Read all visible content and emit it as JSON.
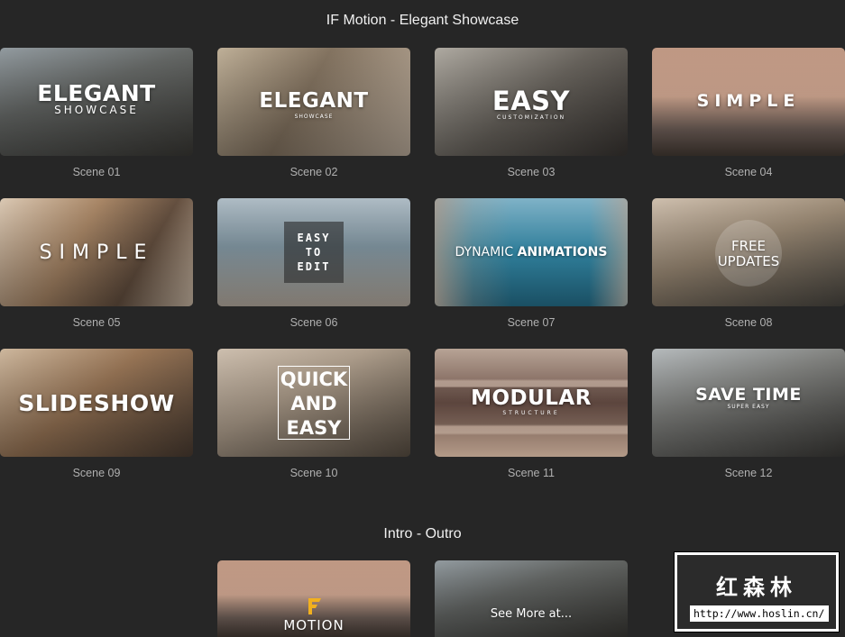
{
  "title": "IF Motion - Elegant Showcase",
  "scenes": [
    {
      "caption": "Scene 01",
      "overlay": [
        "ELEGANT",
        "SHOWCASE"
      ]
    },
    {
      "caption": "Scene 02",
      "overlay": [
        "ELEGANT",
        "SHOWCASE"
      ]
    },
    {
      "caption": "Scene 03",
      "overlay": [
        "EASY",
        "CUSTOMIZATION"
      ]
    },
    {
      "caption": "Scene 04",
      "overlay": [
        "SIMPLE"
      ]
    },
    {
      "caption": "Scene 05",
      "overlay": [
        "SIMPLE"
      ]
    },
    {
      "caption": "Scene 06",
      "overlay": [
        "EASY",
        "TO",
        "EDIT"
      ]
    },
    {
      "caption": "Scene 07",
      "overlay": [
        "DYNAMIC",
        "ANIMATIONS"
      ]
    },
    {
      "caption": "Scene 08",
      "overlay": [
        "FREE",
        "UPDATES"
      ]
    },
    {
      "caption": "Scene 09",
      "overlay": [
        "SLIDESHOW"
      ]
    },
    {
      "caption": "Scene 10",
      "overlay": [
        "QUICK",
        "AND",
        "EASY"
      ]
    },
    {
      "caption": "Scene 11",
      "overlay": [
        "MODULAR",
        "STRUCTURE"
      ]
    },
    {
      "caption": "Scene 12",
      "overlay": [
        "SAVE TIME",
        "SUPER EASY"
      ]
    }
  ],
  "intro_section": {
    "title": "Intro - Outro",
    "cards": [
      {
        "overlay": "MOTION",
        "icon": "if-logo-icon"
      },
      {
        "overlay": "See More at..."
      }
    ]
  },
  "watermark": {
    "chinese": "红森林",
    "url": "http://www.hoslin.cn/"
  },
  "colors": {
    "background": "#262626",
    "caption": "#b0b0b0",
    "logo_gold": "#f2b01e"
  }
}
